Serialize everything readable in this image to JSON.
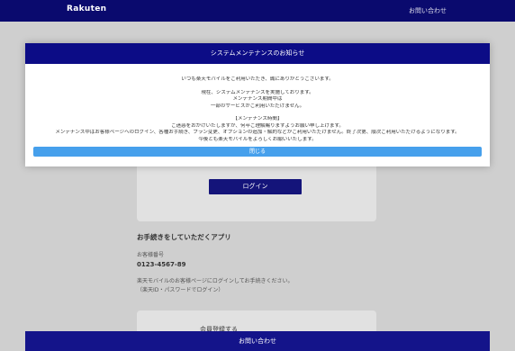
{
  "header": {
    "brand": "Rakuten",
    "right_link": "お問い合わせ"
  },
  "main": {
    "login_button": "ログイン",
    "app_section": {
      "title": "お手続きをしていただくアプリ",
      "label": "お客様番号",
      "value": "0123-4567-89",
      "note_line1": "楽天モバイルのお客様ページにログインしてお手続きください。",
      "note_line2": "（楽天ID・パスワードでログイン）"
    },
    "second_card_label": "会員登録する",
    "bottom_bar_text": "お問い合わせ"
  },
  "modal": {
    "title": "システムメンテナンスのお知らせ",
    "line1": "いつも楽天モバイルをご利用いただき、誠にありがとうございます。",
    "line2": "現在、システムメンテナンスを実施しております。",
    "line3": "メンテナンス期間中は",
    "line4": "一部のサービスがご利用いただけません。",
    "line5": "【メンテナンス時間】",
    "line6": "ご迷惑をおかけいたしますが、何卒ご理解賜りますようお願い申し上げます。",
    "line7": "メンテナンス中はお客様ページへのログイン、各種お手続き、プラン変更、オプションの追加・解約などがご利用いただけません。終了次第、順次ご利用いただけるようになります。",
    "line8": "今後とも楽天モバイルをよろしくお願いいたします。",
    "confirm_button": "閉じる"
  }
}
